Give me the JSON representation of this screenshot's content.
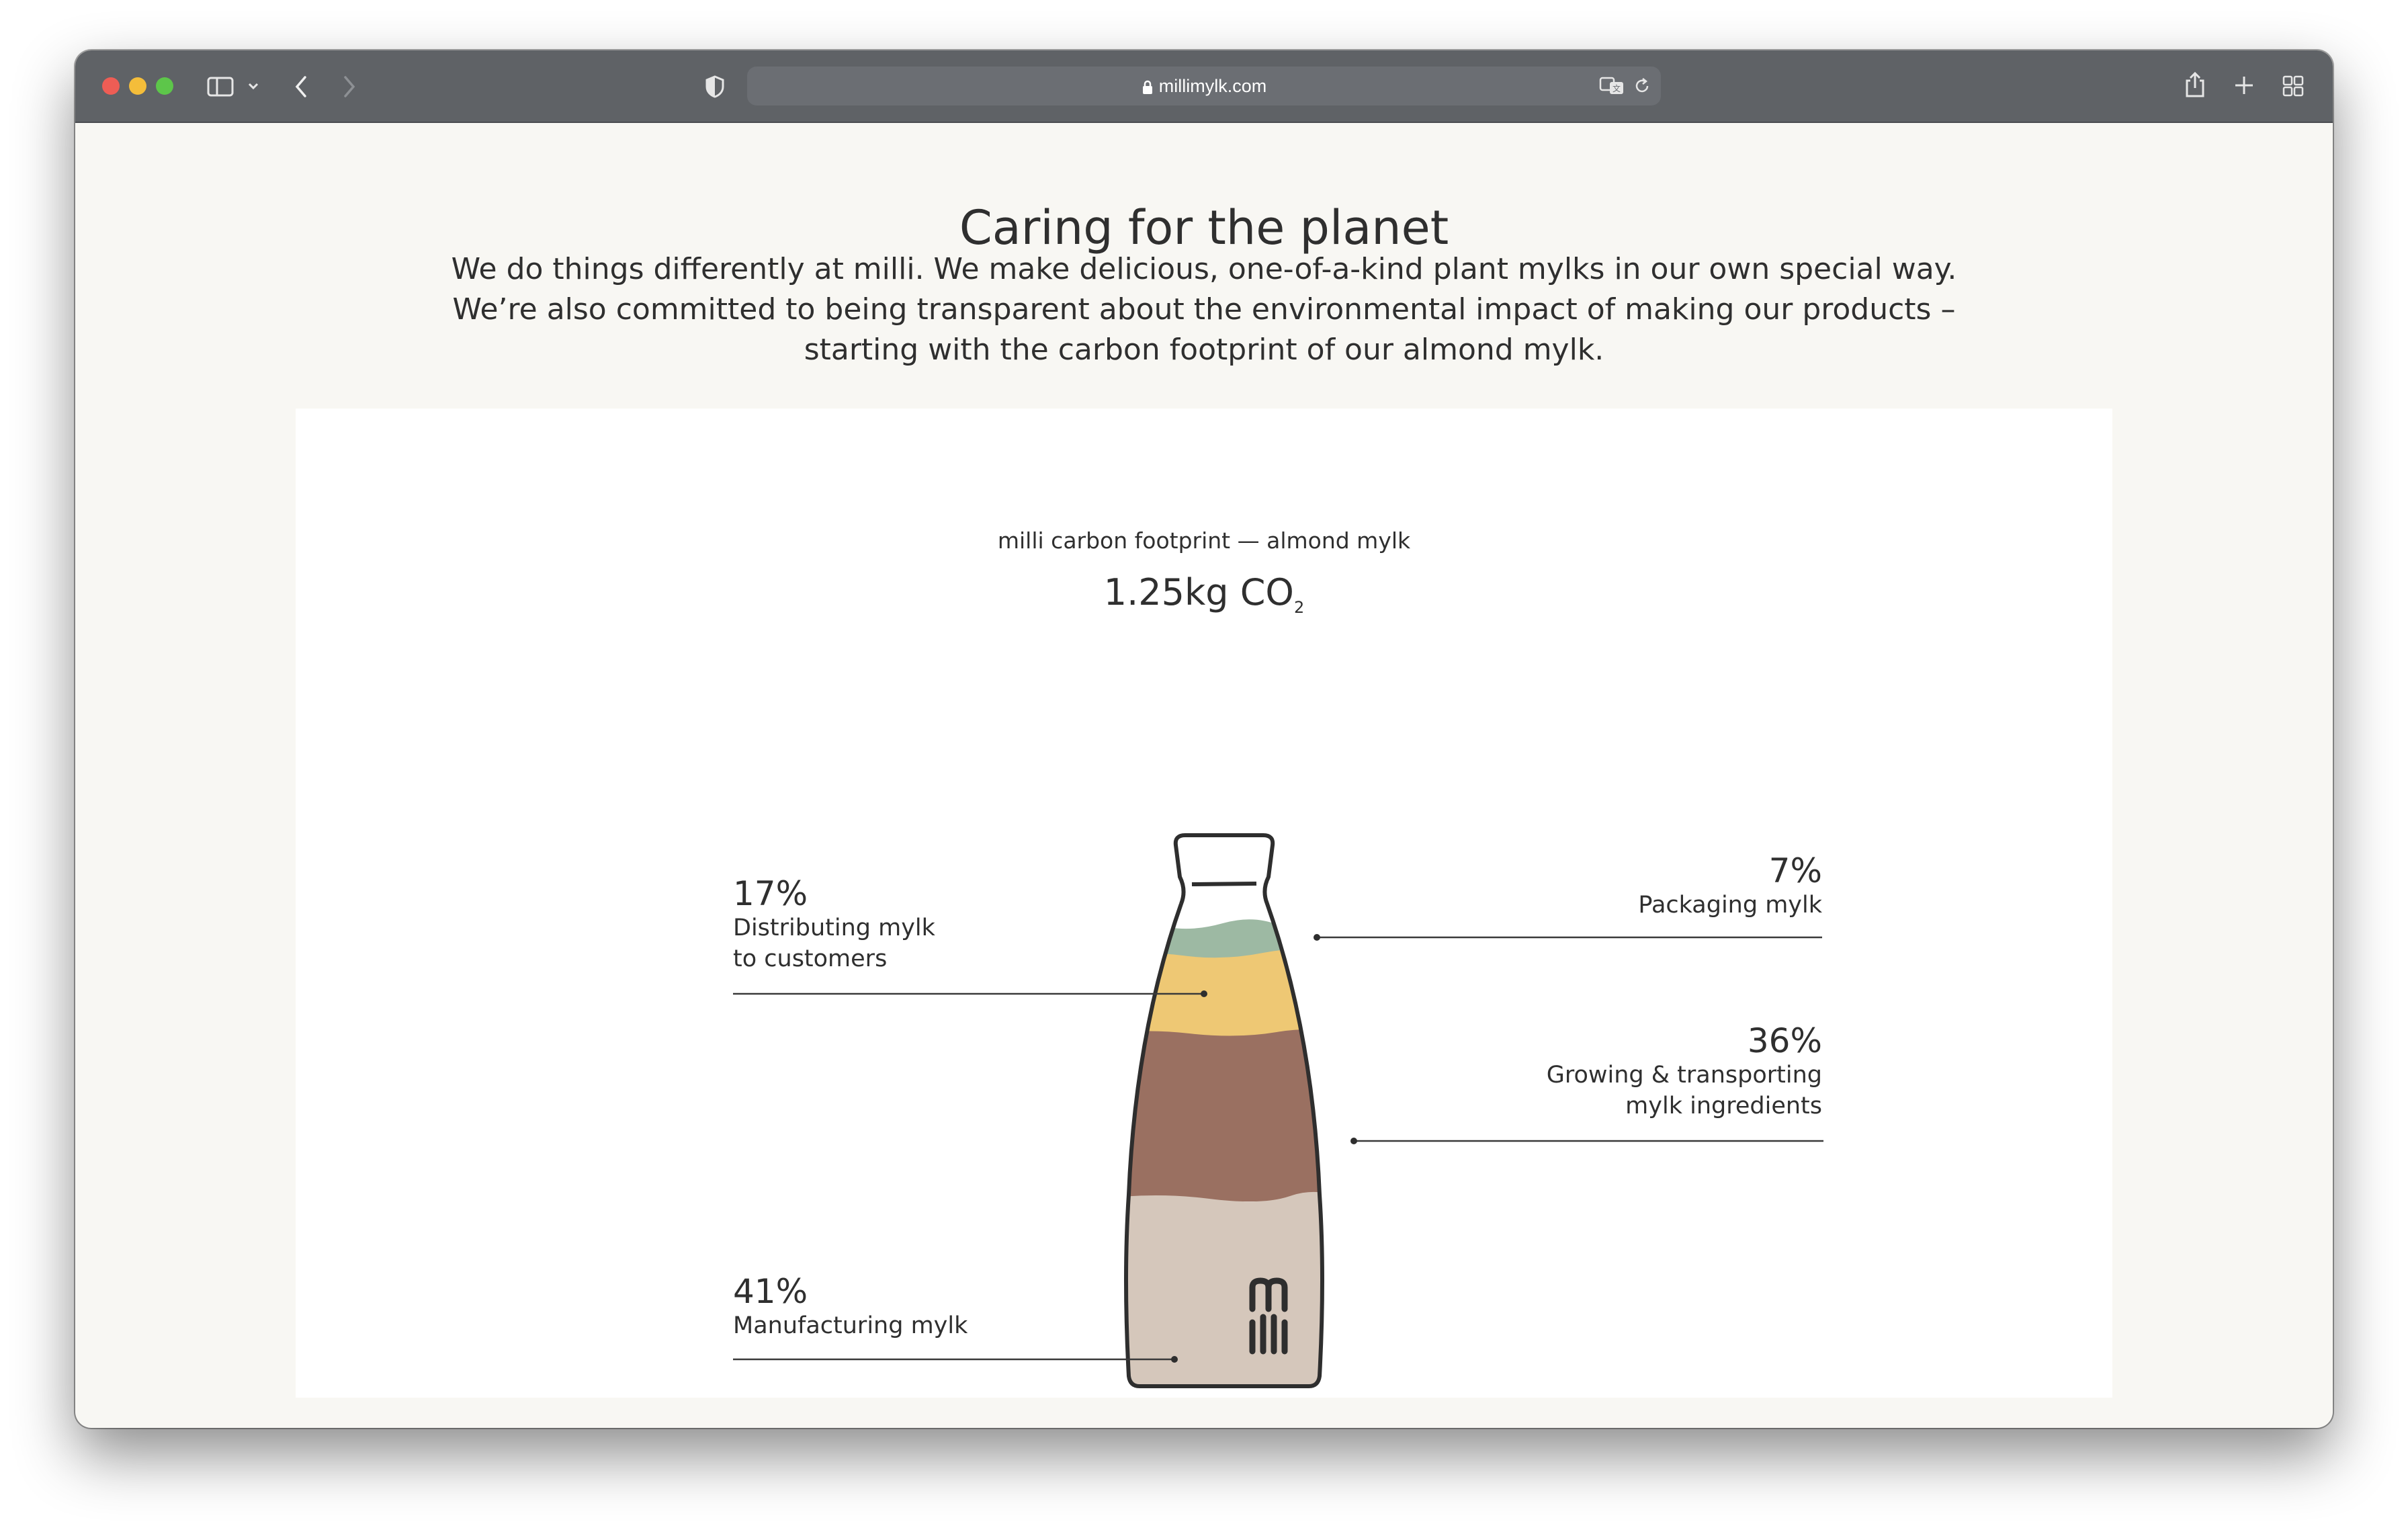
{
  "browser": {
    "url": "millimylk.com"
  },
  "page": {
    "title": "Caring for the planet",
    "intro_lines": [
      "We do things differently at milli. We make delicious, one-of-a-kind plant mylks in our own special way.",
      "We’re also committed to being transparent about the environmental impact of making our products –",
      "starting with the carbon footprint of our almond mylk."
    ]
  },
  "chart": {
    "subtitle": "milli carbon footprint — almond mylk",
    "total_value": "1.25kg CO",
    "total_subscript": "2",
    "labels": {
      "packaging": {
        "pct": "7%",
        "desc_lines": [
          "Packaging mylk"
        ]
      },
      "distributing": {
        "pct": "17%",
        "desc_lines": [
          "Distributing mylk",
          "to customers"
        ]
      },
      "growing": {
        "pct": "36%",
        "desc_lines": [
          "Growing & transporting",
          "mylk ingredients"
        ]
      },
      "manufacturing": {
        "pct": "41%",
        "desc_lines": [
          "Manufacturing mylk"
        ]
      }
    },
    "bottle_logo_text": "m\nilli"
  },
  "chart_data": {
    "type": "stacked-bar",
    "title": "milli carbon footprint — almond mylk",
    "total": "1.25kg CO2",
    "unit": "%",
    "categories": [
      "Packaging mylk",
      "Distributing mylk to customers",
      "Growing & transporting mylk ingredients",
      "Manufacturing mylk"
    ],
    "values": [
      7,
      17,
      36,
      41
    ],
    "colors": [
      "#9db9a3",
      "#eec874",
      "#9a7061",
      "#d5c7bb"
    ]
  }
}
